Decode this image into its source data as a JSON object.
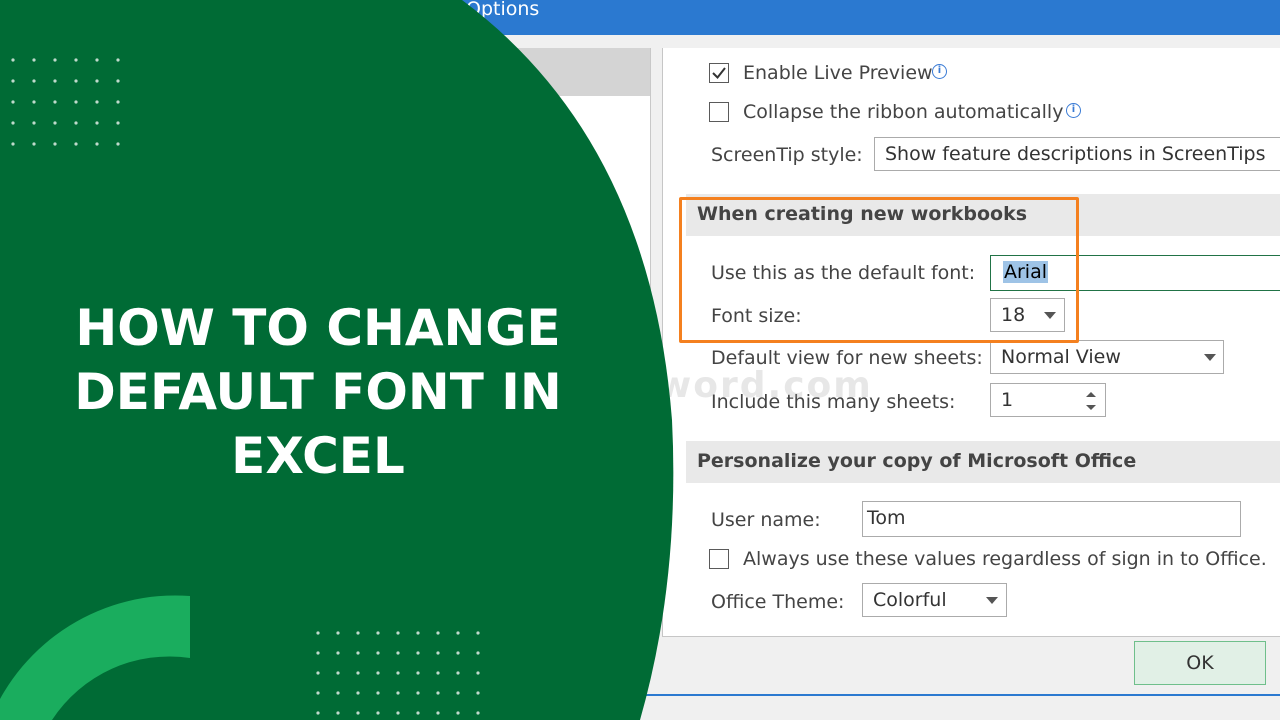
{
  "dialog": {
    "title_fragment": "Options",
    "options": {
      "enable_live_preview": {
        "label": "Enable Live Preview",
        "checked": true
      },
      "collapse_ribbon": {
        "label": "Collapse the ribbon automatically",
        "checked": false
      },
      "screentip_label": "ScreenTip style:",
      "screentip_value": "Show feature descriptions in ScreenTips"
    },
    "new_workbooks": {
      "header": "When creating new workbooks",
      "default_font_label": "Use this as the default font:",
      "default_font_value": "Arial",
      "font_size_label": "Font size:",
      "font_size_value": "18",
      "default_view_label": "Default view for new sheets:",
      "default_view_value": "Normal View",
      "sheets_count_label": "Include this many sheets:",
      "sheets_count_value": "1"
    },
    "personalize": {
      "header": "Personalize your copy of Microsoft Office",
      "user_name_label": "User name:",
      "user_name_value": "Tom",
      "always_use_label": "Always use these values regardless of sign in to Office.",
      "office_theme_label": "Office Theme:",
      "office_theme_value": "Colorful"
    },
    "ok_label": "OK",
    "watermark_text": "word.com"
  },
  "overlay": {
    "headline_lines": [
      "HOW TO CHANGE",
      "DEFAULT FONT IN",
      "EXCEL"
    ],
    "colors": {
      "dark_green": "#006b35",
      "light_green": "#1aad5e",
      "highlight_orange": "#f4801f",
      "excel_blue": "#2b79d0"
    }
  }
}
